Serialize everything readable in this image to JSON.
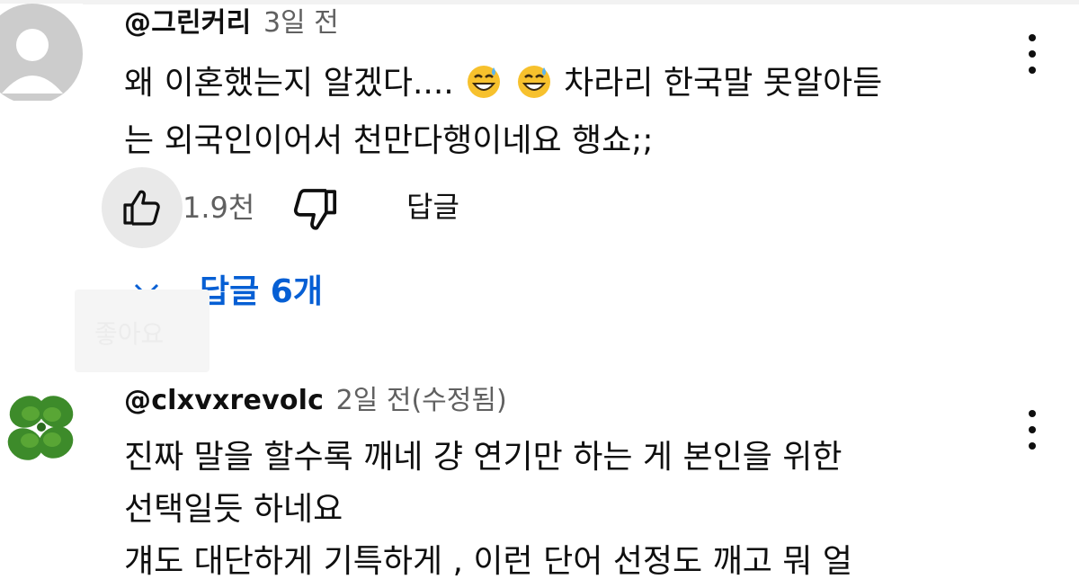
{
  "comments": [
    {
      "author": "@그린커리",
      "time": "3일 전",
      "avatar_icon": "default-user-avatar-icon",
      "text_lines": [
        "왜 이혼했는지 알겠다....",
        "차라리 한국말 못알아듣",
        "는 외국인이어서 천만다행이네요 행쇼;;"
      ],
      "emojis": [
        "grinning-face-with-sweat-icon",
        "grinning-face-with-sweat-icon"
      ],
      "likes": "1.9천",
      "reply_label": "답글",
      "replies_toggle": "답글 6개",
      "tooltip": "좋아요"
    },
    {
      "author": "@clxvxrevolc",
      "time": "2일 전(수정됨)",
      "avatar_icon": "four-leaf-clover-avatar",
      "text_lines": [
        "진짜 말을 할수록 깨네 걍 연기만 하는 게 본인을 위한",
        "선택일듯 하네요",
        "걔도 대단하게 기특하게 , 이런 단어 선정도 깨고 뭐 얼"
      ]
    }
  ],
  "colors": {
    "link_blue": "#065fd4",
    "meta_gray": "#606060",
    "like_button_bg": "#e9e9e9"
  }
}
